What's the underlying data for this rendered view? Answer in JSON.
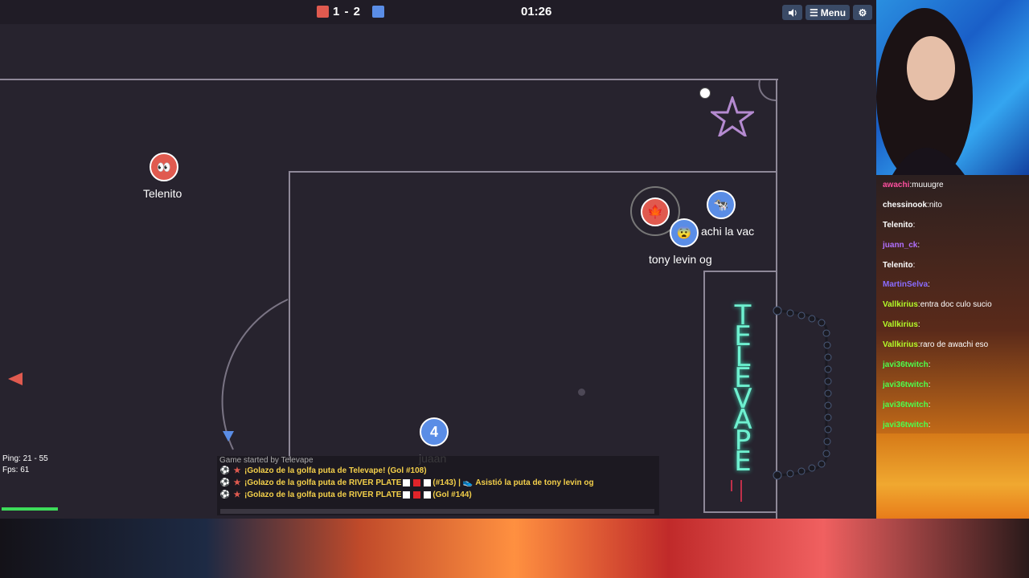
{
  "scoreboard": {
    "score": "1 - 2",
    "timer": "01:26",
    "menu_label": "Menu"
  },
  "players": {
    "telenito": {
      "name": "Telenito"
    },
    "tony": {
      "name": "tony levin og"
    },
    "awachi": {
      "name": "achi la vac"
    },
    "juaan": {
      "name": "juaan",
      "number": "4"
    }
  },
  "field": {
    "logo_letters": [
      "T",
      "E",
      "L",
      "E",
      "V",
      "A",
      "P",
      "E"
    ]
  },
  "stats": {
    "ping": "Ping: 21 - 55",
    "fps": "Fps: 61"
  },
  "game_chat": {
    "system": "Game started by Televape",
    "lines": [
      {
        "text": "¡Golazo de la golfa puta de Televape! (Gol #108)"
      },
      {
        "text_a": "¡Golazo de la golfa puta de RIVER PLATE",
        "text_b": "(#143) |",
        "text_c": "Asistió la puta de tony levin og"
      },
      {
        "text_a": "¡Golazo de la golfa puta de RIVER PLATE",
        "text_b": "(Gol #144)"
      }
    ]
  },
  "stream_chat": [
    {
      "user": "awachi",
      "color": "#ff4fa0",
      "text": "muuugre"
    },
    {
      "user": "chessinook",
      "color": "#ffffff",
      "text": "nito"
    },
    {
      "user": "Telenito",
      "color": "#ffffff",
      "text": ""
    },
    {
      "user": "juann_ck",
      "color": "#b070ff",
      "text": ""
    },
    {
      "user": "Telenito",
      "color": "#ffffff",
      "text": ""
    },
    {
      "user": "MartinSelva",
      "color": "#8a6cff",
      "text": ""
    },
    {
      "user": "Vallkirius",
      "color": "#b4ff2a",
      "text": "entra doc culo sucio"
    },
    {
      "user": "Vallkirius",
      "color": "#b4ff2a",
      "text": ""
    },
    {
      "user": "Vallkirius",
      "color": "#b4ff2a",
      "text": "raro de awachi eso"
    },
    {
      "user": "javi36twitch",
      "color": "#4cff4c",
      "text": ""
    },
    {
      "user": "javi36twitch",
      "color": "#4cff4c",
      "text": ""
    },
    {
      "user": "javi36twitch",
      "color": "#4cff4c",
      "text": ""
    },
    {
      "user": "javi36twitch",
      "color": "#4cff4c",
      "text": ""
    }
  ],
  "colors": {
    "red_team": "#e05a4f",
    "blue_team": "#5a8de6",
    "goal_text": "#f4d04a"
  }
}
